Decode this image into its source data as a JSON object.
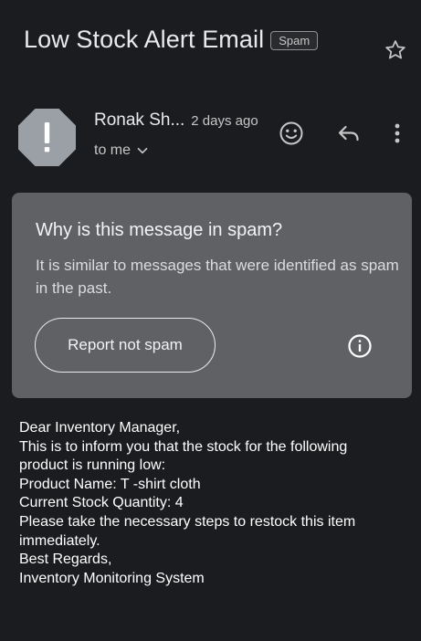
{
  "email": {
    "subject": "Low Stock Alert Email",
    "label": "Spam",
    "sender": "Ronak Sh...",
    "time": "2 days ago",
    "recipient": "to me"
  },
  "spam_notice": {
    "title": "Why is this message in spam?",
    "description": "It is similar to messages that were identified as spam in the past.",
    "button_label": "Report not spam"
  },
  "body_lines": [
    "Dear Inventory Manager,",
    "This is to inform you that the stock for the following",
    "product is running low:",
    "Product Name: T -shirt cloth",
    "Current Stock Quantity: 4",
    "Please take the necessary steps to restock this item",
    "immediately.",
    "Best Regards,",
    "Inventory Monitoring System"
  ],
  "icons": {
    "star": "star-icon",
    "avatar": "exclamation-octagon-icon",
    "emoji": "emoji-icon",
    "reply": "reply-icon",
    "more": "more-vert-icon",
    "expand": "chevron-down-icon",
    "info": "info-icon"
  },
  "colors": {
    "background": "#1b1c1f",
    "spam_card": "#5f6164",
    "avatar": "#9aa0a6"
  }
}
